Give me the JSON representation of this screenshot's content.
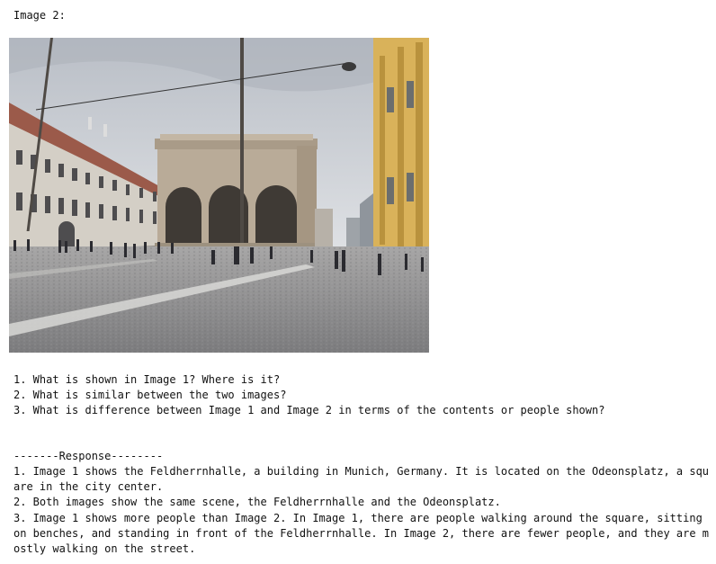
{
  "image_label": "Image 2:",
  "photo": {
    "sky_color": "#c9cdd3",
    "left_building_color": "#9b5a4a",
    "right_building_color": "#d9b25a",
    "loggia_color": "#b9ab98",
    "pavement_color": "#8b8b8d"
  },
  "questions": [
    "1. What is shown in Image 1? Where is it?",
    "2. What is similar between the two images?",
    "3. What is difference between Image 1 and Image 2 in terms of the contents or people shown?"
  ],
  "response_divider": "-------Response--------",
  "response": [
    "1. Image 1 shows the Feldherrnhalle, a building in Munich, Germany. It is located on the Odeonsplatz, a square in the city center.",
    "2. Both images show the same scene, the Feldherrnhalle and the Odeonsplatz.",
    "3. Image 1 shows more people than Image 2. In Image 1, there are people walking around the square, sitting on benches, and standing in front of the Feldherrnhalle. In Image 2, there are fewer people, and they are mostly walking on the street."
  ]
}
